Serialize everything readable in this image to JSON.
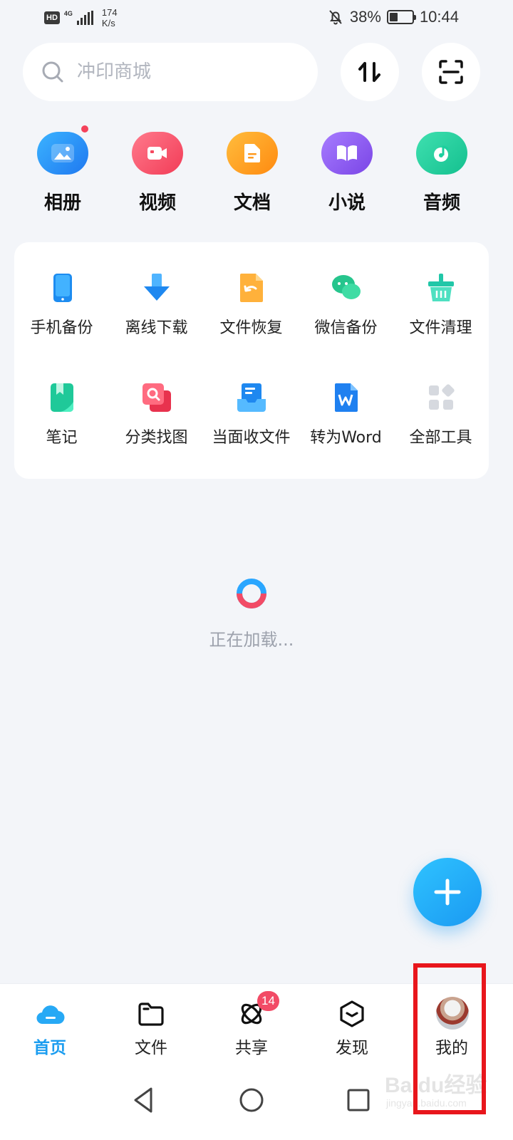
{
  "status_bar": {
    "hd": "HD",
    "network": "4G",
    "speed_value": "174",
    "speed_unit": "K/s",
    "battery": "38%",
    "battery_level": 0.38,
    "time": "10:44",
    "icons": [
      "signal-icon",
      "mute-bell-icon",
      "battery-icon"
    ]
  },
  "search": {
    "placeholder": "冲印商城"
  },
  "top_actions": [
    "transfer-icon",
    "scan-icon"
  ],
  "categories": [
    {
      "label": "相册",
      "icon": "album-icon",
      "color": "#2b8cf5",
      "has_dot": true
    },
    {
      "label": "视频",
      "icon": "video-icon",
      "color": "#f5485f"
    },
    {
      "label": "文档",
      "icon": "document-icon",
      "color": "#ff9a1f"
    },
    {
      "label": "小说",
      "icon": "book-icon",
      "color": "#8e5bf0"
    },
    {
      "label": "音频",
      "icon": "music-icon",
      "color": "#1ccf9d"
    }
  ],
  "tools": [
    {
      "label": "手机备份",
      "icon": "phone-backup-icon"
    },
    {
      "label": "离线下载",
      "icon": "offline-download-icon"
    },
    {
      "label": "文件恢复",
      "icon": "file-restore-icon"
    },
    {
      "label": "微信备份",
      "icon": "wechat-backup-icon"
    },
    {
      "label": "文件清理",
      "icon": "file-cleanup-icon"
    },
    {
      "label": "笔记",
      "icon": "notes-icon"
    },
    {
      "label": "分类找图",
      "icon": "image-search-icon"
    },
    {
      "label": "当面收文件",
      "icon": "receive-file-icon"
    },
    {
      "label": "转为Word",
      "icon": "word-convert-icon"
    },
    {
      "label": "全部工具",
      "icon": "all-tools-icon"
    }
  ],
  "loading": {
    "text": "正在加载..."
  },
  "fab": {
    "icon": "plus-icon"
  },
  "bottom_nav": [
    {
      "label": "首页",
      "icon": "home-cloud-icon",
      "active": true
    },
    {
      "label": "文件",
      "icon": "folder-icon"
    },
    {
      "label": "共享",
      "icon": "share-orbit-icon",
      "badge": "14"
    },
    {
      "label": "发现",
      "icon": "discover-icon"
    },
    {
      "label": "我的",
      "icon": "avatar"
    }
  ],
  "system_nav": [
    "back-icon",
    "home-icon",
    "recents-icon"
  ],
  "watermark": {
    "text": "Baidu经验",
    "sub": "jingyan.baidu.com"
  },
  "colors": {
    "accent": "#1b9df0",
    "badge": "#f24b66",
    "highlight": "#e8161c",
    "background": "#f3f5f9"
  }
}
